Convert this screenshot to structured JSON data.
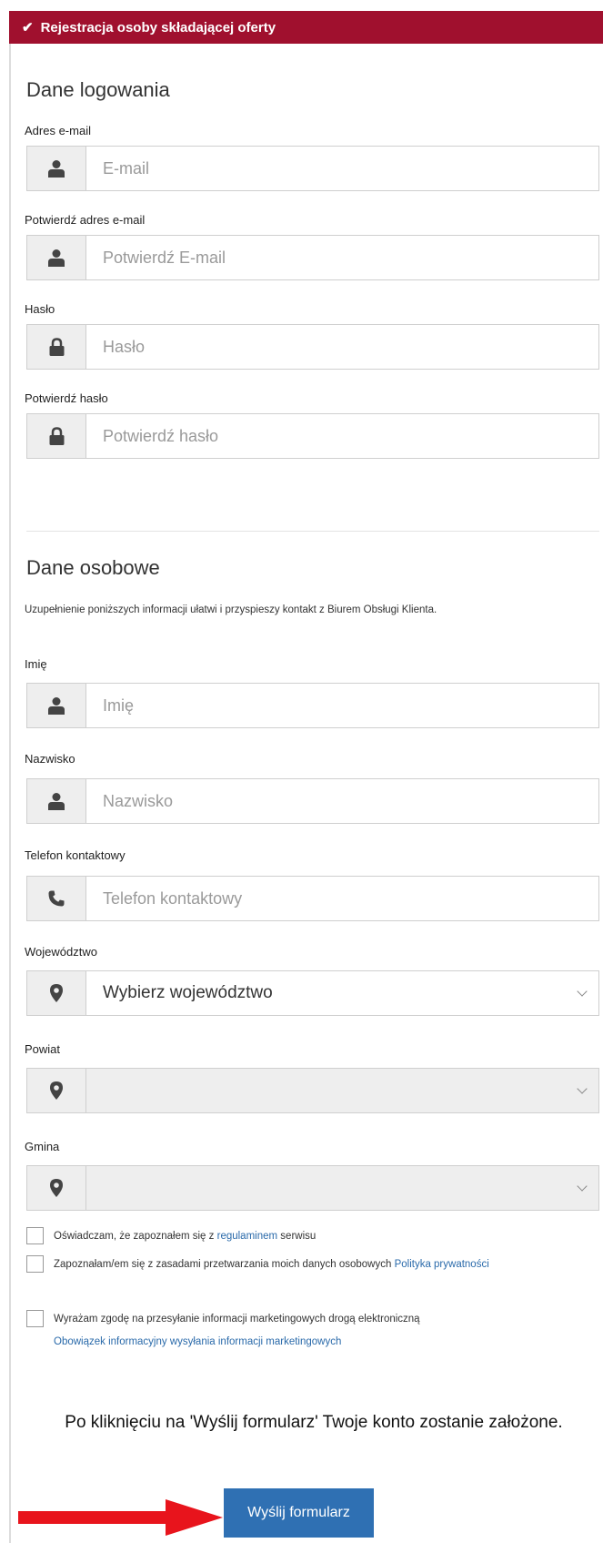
{
  "header": {
    "title": "Rejestracja osoby składającej oferty"
  },
  "login": {
    "title": "Dane logowania",
    "email": {
      "label": "Adres e-mail",
      "placeholder": "E-mail"
    },
    "email_confirm": {
      "label": "Potwierdź adres e-mail",
      "placeholder": "Potwierdź E-mail"
    },
    "password": {
      "label": "Hasło",
      "placeholder": "Hasło"
    },
    "password_confirm": {
      "label": "Potwierdź hasło",
      "placeholder": "Potwierdź hasło"
    }
  },
  "personal": {
    "title": "Dane osobowe",
    "info": "Uzupełnienie poniższych informacji ułatwi i przyspieszy kontakt z Biurem Obsługi Klienta.",
    "first_name": {
      "label": "Imię",
      "placeholder": "Imię"
    },
    "last_name": {
      "label": "Nazwisko",
      "placeholder": "Nazwisko"
    },
    "phone": {
      "label": "Telefon kontaktowy",
      "placeholder": "Telefon kontaktowy"
    },
    "voivodeship": {
      "label": "Województwo",
      "value": "Wybierz województwo"
    },
    "county": {
      "label": "Powiat",
      "value": ""
    },
    "commune": {
      "label": "Gmina",
      "value": ""
    }
  },
  "consents": {
    "terms": {
      "text": "Oświadczam, że zapoznałem się z",
      "link": "regulaminem",
      "suffix": "serwisu"
    },
    "privacy": {
      "text": "Zapoznałam/em się z zasadami przetwarzania moich danych osobowych",
      "link": "Polityka prywatności"
    },
    "marketing": {
      "text": "Wyrażam zgodę na przesyłanie informacji marketingowych drogą elektroniczną",
      "link": "Obowiązek informacyjny wysyłania informacji marketingowych"
    }
  },
  "note": "Po kliknięciu na 'Wyślij formularz' Twoje konto zostanie założone.",
  "submit_label": "Wyślij formularz",
  "colors": {
    "header": "#a0102e",
    "button": "#2f70b3",
    "link": "#2a6aaa",
    "arrow": "#e8141c"
  },
  "icons": [
    "check-icon",
    "user-icon",
    "lock-icon",
    "phone-icon",
    "map-pin-icon",
    "chevron-down-icon",
    "arrow-right-icon"
  ]
}
